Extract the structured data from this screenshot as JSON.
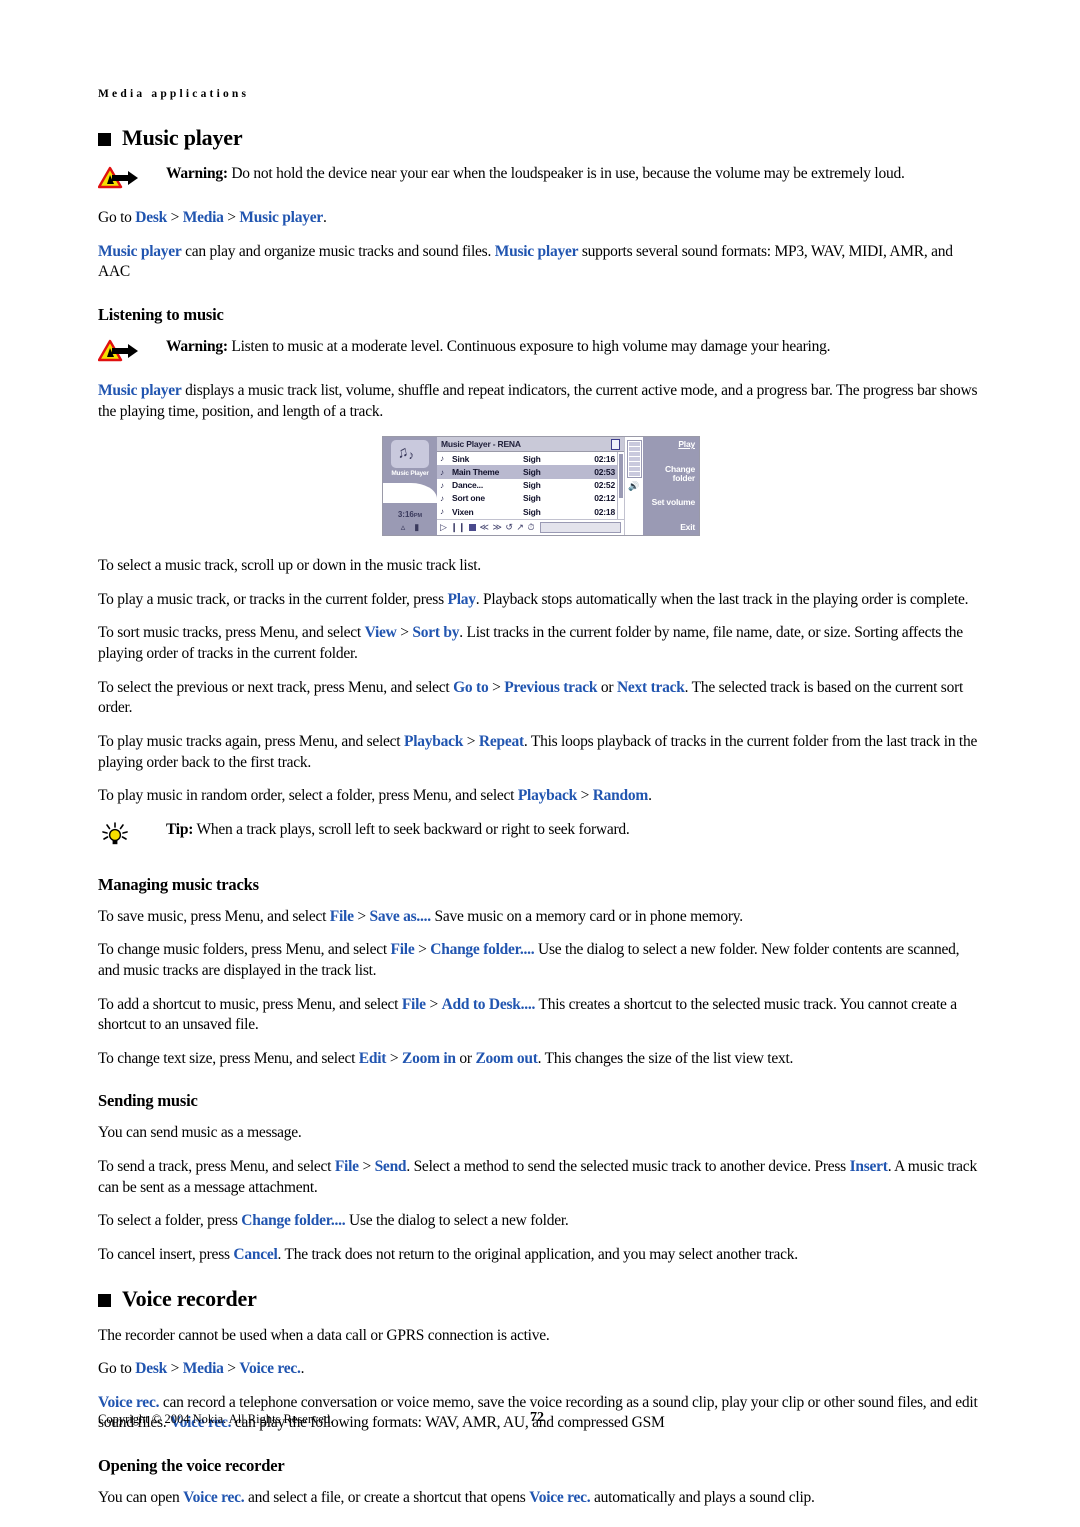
{
  "page": {
    "running_header": "Media applications",
    "footer_copyright": "Copyright © 2004 Nokia. All Rights Reserved.",
    "page_number": "72",
    "link_color": "#2155b0"
  },
  "music_player": {
    "heading": "Music player",
    "warning1": {
      "label": "Warning:",
      "text": " Do not hold the device near your ear when the loudspeaker is in use, because the volume may be extremely loud."
    },
    "goto": {
      "prefix": "Go to ",
      "link1": "Desk",
      "sep1": " > ",
      "link2": "Media",
      "sep2": " > ",
      "link3": "Music player",
      "suffix": "."
    },
    "intro_a": "Music player",
    "intro_b": " can play and organize music tracks and sound files. ",
    "intro_c": "Music player",
    "intro_d": " supports several sound formats: MP3, WAV, MIDI, AMR, and AAC"
  },
  "listening": {
    "heading": "Listening to music",
    "warning2": {
      "label": "Warning:",
      "text": " Listen to music at a moderate level. Continuous exposure to high volume may damage your hearing."
    },
    "desc_link": "Music player",
    "desc_rest": " displays a music track list, volume, shuffle and repeat indicators, the current active mode, and a progress bar. The progress bar shows the playing time, position, and length of a track.",
    "p_select": "To select a music track, scroll up or down in the music track list.",
    "p_play_a": "To play a music track, or tracks in the current folder, press ",
    "p_play_link": "Play",
    "p_play_b": ". Playback stops automatically when the last track in the playing order is complete.",
    "p_sort_a": "To sort music tracks, press Menu, and select ",
    "p_sort_link1": "View",
    "p_sort_sep": " > ",
    "p_sort_link2": "Sort by",
    "p_sort_b": ". List tracks in the current folder by name, file name, date, or size. Sorting affects the playing order of tracks in the current folder.",
    "p_prev_a": "To select the previous or next track, press Menu, and select ",
    "p_prev_link1": "Go to",
    "p_prev_sep": " > ",
    "p_prev_link2": "Previous track",
    "p_prev_or": " or ",
    "p_prev_link3": "Next track",
    "p_prev_b": ". The selected track is based on the current sort order.",
    "p_repeat_a": "To play music tracks again, press Menu, and select ",
    "p_repeat_link1": "Playback",
    "p_repeat_sep": " > ",
    "p_repeat_link2": "Repeat",
    "p_repeat_b": ". This loops playback of tracks in the current folder from the last track in the playing order back to the first track.",
    "p_random_a": "To play music in random order, select a folder, press Menu, and select ",
    "p_random_link1": "Playback",
    "p_random_sep": " > ",
    "p_random_link2": "Random",
    "p_random_b": ".",
    "tip": {
      "label": "Tip:",
      "text": " When a track plays, scroll left to seek backward or right to seek forward."
    }
  },
  "device_screenshot": {
    "app_label": "Music Player",
    "title": "Music Player - RENA",
    "clock": "3:16",
    "clock_ampm": "PM",
    "tracks": [
      {
        "name": "Sink",
        "artist": "Sigh",
        "duration": "02:16",
        "selected": false
      },
      {
        "name": "Main Theme",
        "artist": "Sigh",
        "duration": "02:53",
        "selected": true
      },
      {
        "name": "Dance...",
        "artist": "Sigh",
        "duration": "02:52",
        "selected": false
      },
      {
        "name": "Sort one",
        "artist": "Sigh",
        "duration": "02:12",
        "selected": false
      },
      {
        "name": "Vixen",
        "artist": "Sigh",
        "duration": "02:18",
        "selected": false
      }
    ],
    "commands": [
      "Play",
      "Change folder",
      "Set volume",
      "Exit"
    ],
    "transport_icons": [
      "play-icon",
      "pause-icon",
      "stop-icon",
      "rewind-icon",
      "fast-forward-icon",
      "repeat-icon",
      "shuffle-icon",
      "clock-icon"
    ]
  },
  "managing": {
    "heading": "Managing music tracks",
    "p_save_a": "To save music, press Menu, and select ",
    "p_save_link1": "File",
    "p_save_sep": " > ",
    "p_save_link2": "Save as....",
    "p_save_b": " Save music on a memory card or in phone memory.",
    "p_folder_a": "To change music folders, press Menu, and select ",
    "p_folder_link1": "File",
    "p_folder_sep": " > ",
    "p_folder_link2": "Change folder....",
    "p_folder_b": " Use the dialog to select a new folder. New folder contents are scanned, and music tracks are displayed in the track list.",
    "p_shortcut_a": "To add a shortcut to music, press Menu, and select ",
    "p_shortcut_link1": "File",
    "p_shortcut_sep": " > ",
    "p_shortcut_link2": "Add to Desk....",
    "p_shortcut_b": " This creates a shortcut to the selected music track. You cannot create a shortcut to an unsaved file.",
    "p_zoom_a": "To change text size, press Menu, and select ",
    "p_zoom_link1": "Edit",
    "p_zoom_sep": " > ",
    "p_zoom_link2": "Zoom in",
    "p_zoom_or": " or ",
    "p_zoom_link3": "Zoom out",
    "p_zoom_b": ". This changes the size of the list view text."
  },
  "sending": {
    "heading": "Sending music",
    "p_intro": "You can send music as a message.",
    "p_send_a": "To send a track, press Menu, and select ",
    "p_send_link1": "File",
    "p_send_sep": " > ",
    "p_send_link2": "Send",
    "p_send_b": ". Select a method to send the selected music track to another device. Press ",
    "p_send_link3": "Insert",
    "p_send_c": ". A music track can be sent as a message attachment.",
    "p_selfolder_a": "To select a folder, press ",
    "p_selfolder_link": "Change folder....",
    "p_selfolder_b": " Use the dialog to select a new folder.",
    "p_cancel_a": "To cancel insert, press ",
    "p_cancel_link": "Cancel",
    "p_cancel_b": ". The track does not return to the original application, and you may select another track."
  },
  "voice_recorder": {
    "heading": "Voice recorder",
    "p_gprs": "The recorder cannot be used when a data call or GPRS connection is active.",
    "goto": {
      "prefix": "Go to ",
      "link1": "Desk",
      "sep1": " > ",
      "link2": "Media",
      "sep2": " > ",
      "link3": "Voice rec.",
      "suffix": "."
    },
    "p_desc_link1": "Voice rec.",
    "p_desc_a": " can record a telephone conversation or voice memo, save the voice recording as a sound clip, play your clip or other sound files, and edit sound files. ",
    "p_desc_link2": "Voice rec.",
    "p_desc_b": " can play the following formats: WAV, AMR, AU, and compressed GSM",
    "opening_heading": "Opening the voice recorder",
    "p_open_a": "You can open ",
    "p_open_link1": "Voice rec.",
    "p_open_b": " and select a file, or create a shortcut that opens ",
    "p_open_link2": "Voice rec.",
    "p_open_c": " automatically and plays a sound clip."
  }
}
